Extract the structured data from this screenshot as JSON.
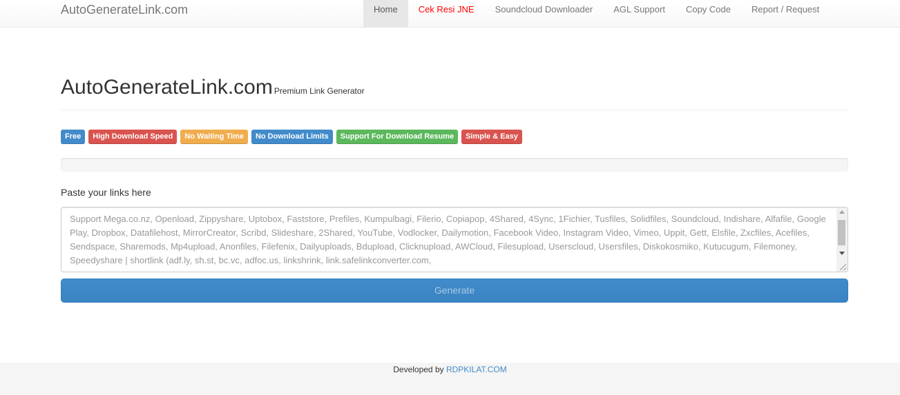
{
  "navbar": {
    "brand": "AutoGenerateLink.com",
    "items": [
      {
        "label": "Home"
      },
      {
        "label": "Cek Resi JNE"
      },
      {
        "label": "Soundcloud Downloader"
      },
      {
        "label": "AGL Support"
      },
      {
        "label": "Copy Code"
      },
      {
        "label": "Report / Request"
      }
    ]
  },
  "header": {
    "title": "AutoGenerateLink.com",
    "subtitle": "Premium Link Generator"
  },
  "labels": [
    {
      "text": "Free",
      "color": "#428bca"
    },
    {
      "text": "High Download Speed",
      "color": "#d9534f"
    },
    {
      "text": "No Waiting Time",
      "color": "#f0ad4e"
    },
    {
      "text": "No Download Limits",
      "color": "#428bca"
    },
    {
      "text": "Support For Download Resume",
      "color": "#5cb85c"
    },
    {
      "text": "Simple & Easy",
      "color": "#d9534f"
    }
  ],
  "form": {
    "paste_label": "Paste your links here",
    "placeholder": "Support Mega.co.nz, Openload, Zippyshare, Uptobox, Faststore, Prefiles, Kumpulbagi, Filerio, Copiapop, 4Shared, 4Sync, 1Fichier, Tusfiles, Solidfiles, Soundcloud, Indishare, Alfafile, Google Play, Dropbox, Datafilehost, MirrorCreator, Scribd, Slideshare, 2Shared, YouTube, Vodlocker, Dailymotion, Facebook Video, Instagram Video, Vimeo, Uppit, Gett, Elsfile,  Zxcfiles,  Acefiles,  Sendspace, Sharemods, Mp4upload, Anonfiles, Filefenix, Dailyuploads, Bdupload, Clicknupload, AWCloud, Filesupload, Userscloud, Usersfiles, Diskokosmiko, Kutucugum, Filemoney, Speedyshare | shortlink (adf.ly, sh.st, bc.vc, adfoc.us, linkshrink, link.safelinkconverter.com,",
    "generate_label": "Generate"
  },
  "footer": {
    "prefix": "Developed by",
    "link": "RDPKILAT.COM"
  },
  "colors": {
    "primary": "#428bca",
    "danger": "#d9534f",
    "warning": "#f0ad4e",
    "success": "#5cb85c"
  }
}
